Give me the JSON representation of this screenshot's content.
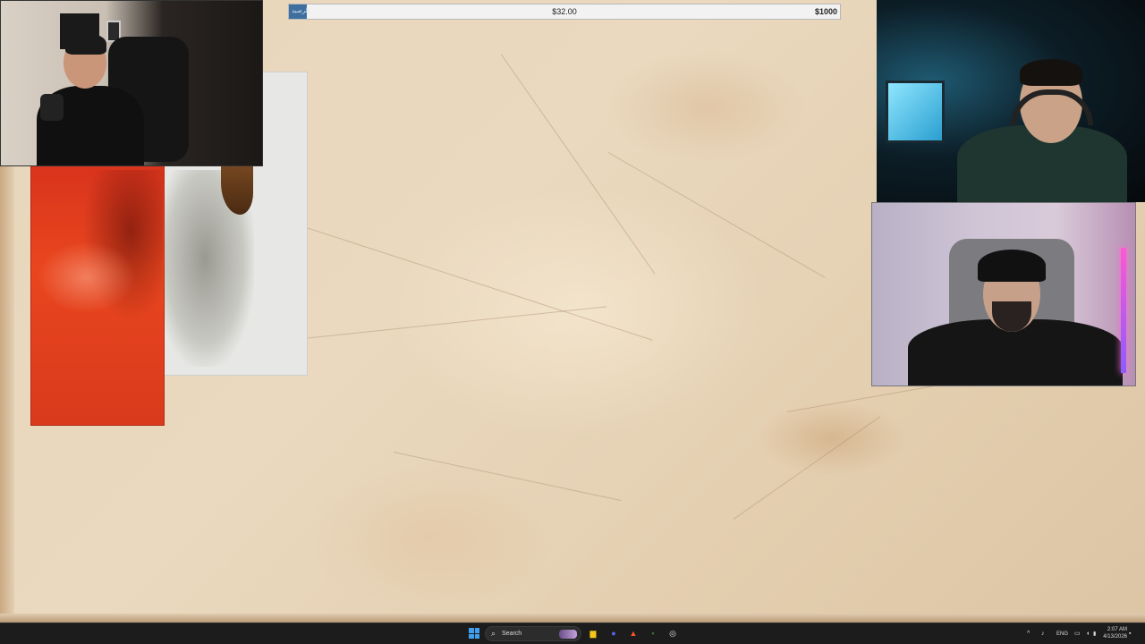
{
  "money_bar": {
    "current_amount": "$32.00",
    "goal_amount": "$1000",
    "fill_label": "الرصيد",
    "progress": 0.032,
    "fill_color": "#3f6f9e"
  },
  "colors": {
    "parchment": "#e8d6bb",
    "art_red": "#e9461f",
    "taskbar": "#1c1c1c"
  },
  "taskbar": {
    "start_icon": "windows-start-icon",
    "search_label": "Search",
    "apps": [
      {
        "name": "file-explorer-icon",
        "glyph": "▆",
        "color": "#f5c518"
      },
      {
        "name": "discord-icon",
        "glyph": "●",
        "color": "#5865f2"
      },
      {
        "name": "brave-browser-icon",
        "glyph": "▲",
        "color": "#fb542b"
      },
      {
        "name": "terminal-icon",
        "glyph": "▪",
        "color": "#2e7d32"
      },
      {
        "name": "obs-icon",
        "glyph": "◎",
        "color": "#e0e0e0"
      }
    ],
    "tray": {
      "chevron": "^",
      "language": "ENG",
      "time": "2:07 AM",
      "date": "4/13/2026"
    }
  }
}
